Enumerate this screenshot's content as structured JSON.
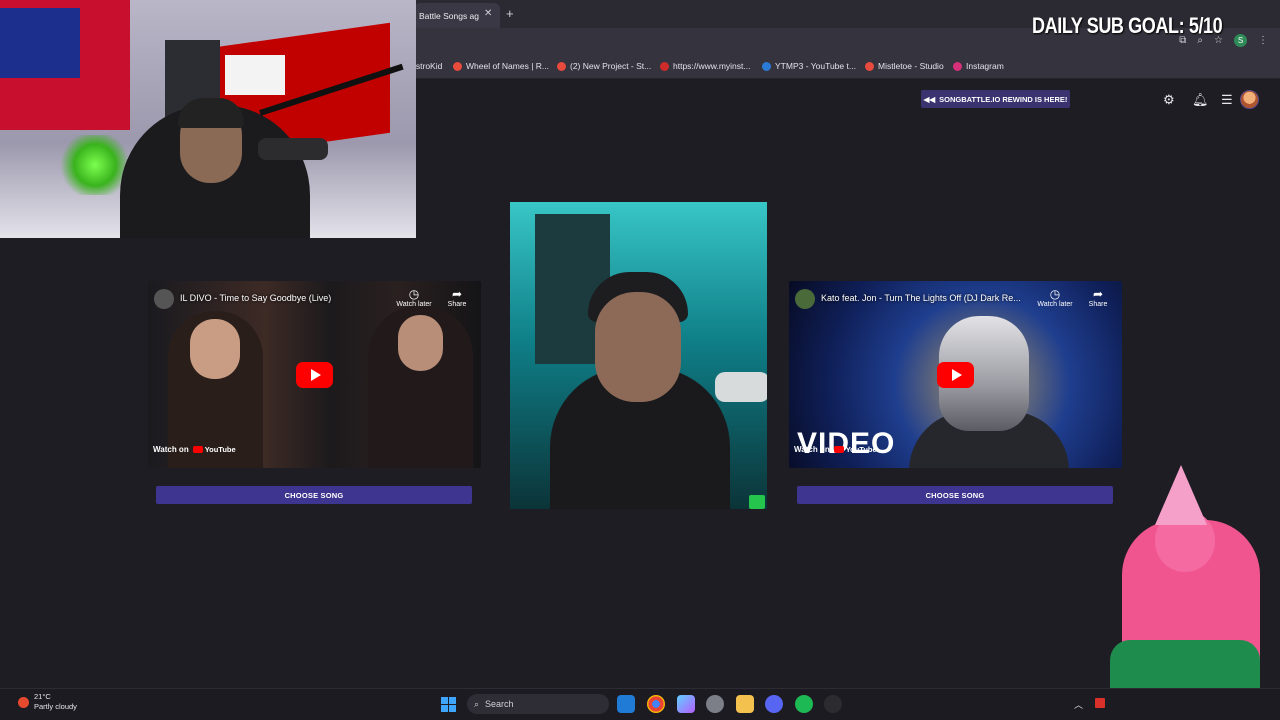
{
  "overlay": {
    "sub_goal": "DAILY SUB GOAL: 5/10"
  },
  "browser": {
    "tab_title": "Battle Songs ag",
    "bookmarks": [
      {
        "label": "istroKid",
        "color": "#3a3844"
      },
      {
        "label": "Wheel of Names | R...",
        "color": "#e94b3c"
      },
      {
        "label": "(2) New Project - St...",
        "color": "#e84a3d"
      },
      {
        "label": "https://www.myinst...",
        "color": "#cf2b2b"
      },
      {
        "label": "YTMP3 - YouTube t...",
        "color": "#2b7bd6"
      },
      {
        "label": "Mistletoe - Studio",
        "color": "#e84a3d"
      },
      {
        "label": "Instagram",
        "color": "#d6307a"
      }
    ],
    "profile_initial": "S"
  },
  "site": {
    "rewind_banner": "SONGBATTLE.IO REWIND IS HERE!",
    "choose_label": "CHOOSE SONG"
  },
  "players": {
    "left": {
      "title": "IL DIVO - Time to Say Goodbye (Live)",
      "watch_later": "Watch later",
      "share": "Share",
      "watch_on": "Watch on",
      "youtube": "YouTube"
    },
    "right": {
      "title": "Kato feat. Jon - Turn The Lights Off (DJ Dark Re...",
      "watch_later": "Watch later",
      "share": "Share",
      "watch_on": "Watch on",
      "youtube": "YouTube",
      "overlay_word": "VIDEO"
    }
  },
  "taskbar": {
    "temperature": "21°C",
    "weather": "Partly cloudy",
    "search_placeholder": "Search"
  },
  "colors": {
    "accent_button": "#3d3590",
    "rewind_banner": "#3b3370",
    "youtube_red": "#ff0000",
    "page_bg": "#1f1d24"
  }
}
